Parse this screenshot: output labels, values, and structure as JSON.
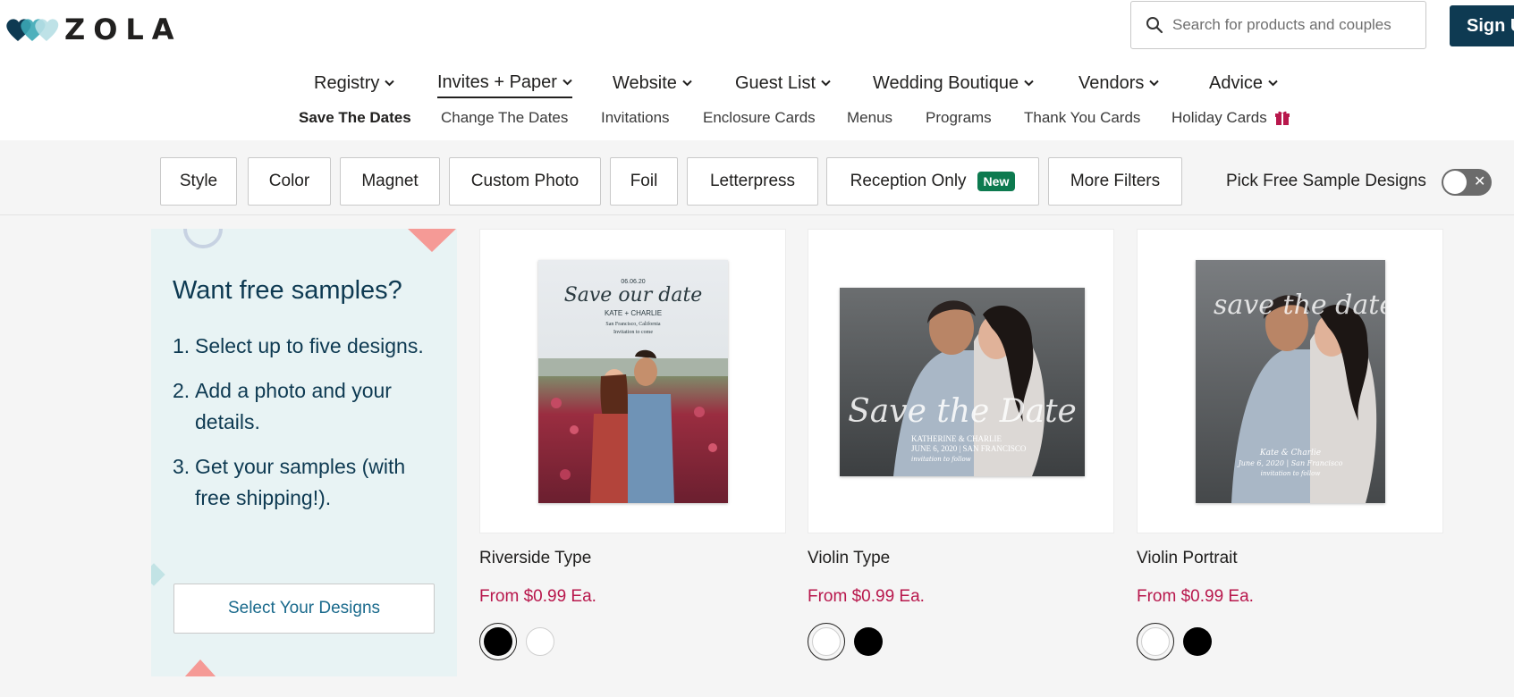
{
  "header": {
    "logo_text": "ZOLA",
    "search_placeholder": "Search for products and couples",
    "signup_label": "Sign Up"
  },
  "main_nav": [
    {
      "label": "Registry"
    },
    {
      "label": "Invites + Paper",
      "active": true
    },
    {
      "label": "Website"
    },
    {
      "label": "Guest List"
    },
    {
      "label": "Wedding Boutique"
    },
    {
      "label": "Vendors"
    },
    {
      "label": "Advice"
    }
  ],
  "sub_nav": [
    {
      "label": "Save The Dates",
      "active": true
    },
    {
      "label": "Change The Dates"
    },
    {
      "label": "Invitations"
    },
    {
      "label": "Enclosure Cards"
    },
    {
      "label": "Menus"
    },
    {
      "label": "Programs"
    },
    {
      "label": "Thank You Cards"
    },
    {
      "label": "Holiday Cards",
      "icon": "gift-icon"
    }
  ],
  "filters": [
    {
      "label": "Style"
    },
    {
      "label": "Color"
    },
    {
      "label": "Magnet"
    },
    {
      "label": "Custom Photo"
    },
    {
      "label": "Foil"
    },
    {
      "label": "Letterpress"
    },
    {
      "label": "Reception Only",
      "badge": "New"
    },
    {
      "label": "More Filters"
    }
  ],
  "pick_free": {
    "label": "Pick Free Sample Designs",
    "on": false
  },
  "promo": {
    "title": "Want free samples?",
    "steps": [
      {
        "num": "1.",
        "text": "Select up to five designs."
      },
      {
        "num": "2.",
        "text": "Add a photo and your details."
      },
      {
        "num": "3.",
        "text": "Get your samples (with free shipping!)."
      }
    ],
    "button": "Select Your Designs"
  },
  "products": [
    {
      "name": "Riverside Type",
      "price": "From $0.99 Ea.",
      "card_text": [
        "06.06.20",
        "Save our date",
        "KATE + CHARLIE",
        "San Francisco, California",
        "Invitation to come"
      ],
      "swatches": [
        "black",
        "white"
      ],
      "selected": 0
    },
    {
      "name": "Violin Type",
      "price": "From $0.99 Ea.",
      "card_text": [
        "Save the Date",
        "KATHERINE & CHARLIE",
        "JUNE 6, 2020 | SAN FRANCISCO",
        "invitation to follow"
      ],
      "swatches": [
        "white",
        "black"
      ],
      "selected": 0
    },
    {
      "name": "Violin Portrait",
      "price": "From $0.99 Ea.",
      "card_text": [
        "save the date",
        "Kate & Charlie",
        "June 6, 2020 | San Francisco",
        "invitation to follow"
      ],
      "swatches": [
        "white",
        "black"
      ],
      "selected": 0
    }
  ],
  "colors": {
    "brand_navy": "#0e3a52",
    "price": "#b8174c",
    "new_badge": "#0d7a4f",
    "promo_bg": "#e8f3f4"
  }
}
